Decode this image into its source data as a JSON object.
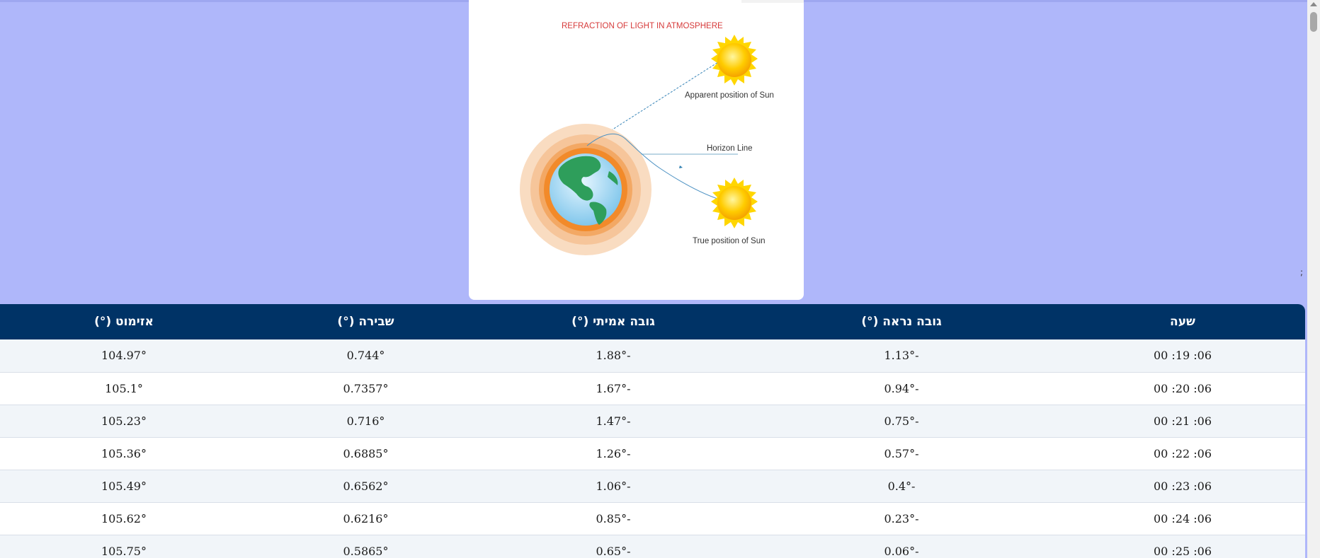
{
  "figure": {
    "title": "REFRACTION OF LIGHT IN ATMOSPHERE",
    "apparent_label": "Apparent position of Sun",
    "horizon_label": "Horizon Line",
    "true_label": "True position of Sun",
    "colors": {
      "title": "#d63a3a",
      "sun": "#ffcc00",
      "atmosphere_outer": "#f8d7b8",
      "atmosphere_inner": "#f28a2a",
      "ocean": "#8fd0f0",
      "land": "#2e9e5b",
      "ray": "#2f7fb0"
    }
  },
  "stray_mark": ";",
  "table": {
    "headers": [
      "שעה",
      "גובה נראה (°)",
      "גובה אמיתי (°)",
      "שבירה (°)",
      "אזימוט (°)"
    ],
    "rows": [
      [
        "06: 19: 00",
        "-1.13°",
        "-1.88°",
        "0.744°",
        "104.97°"
      ],
      [
        "06: 20: 00",
        "-0.94°",
        "-1.67°",
        "0.7357°",
        "105.1°"
      ],
      [
        "06: 21: 00",
        "-0.75°",
        "-1.47°",
        "0.716°",
        "105.23°"
      ],
      [
        "06: 22: 00",
        "-0.57°",
        "-1.26°",
        "0.6885°",
        "105.36°"
      ],
      [
        "06: 23: 00",
        "-0.4°",
        "-1.06°",
        "0.6562°",
        "105.49°"
      ],
      [
        "06: 24: 00",
        "-0.23°",
        "-0.85°",
        "0.6216°",
        "105.62°"
      ],
      [
        "06: 25: 00",
        "-0.06°",
        "-0.65°",
        "0.5865°",
        "105.75°"
      ]
    ]
  },
  "colors": {
    "page_background": "#afb7fa",
    "header_background": "#003366",
    "row_alt": "#f1f5f9"
  }
}
